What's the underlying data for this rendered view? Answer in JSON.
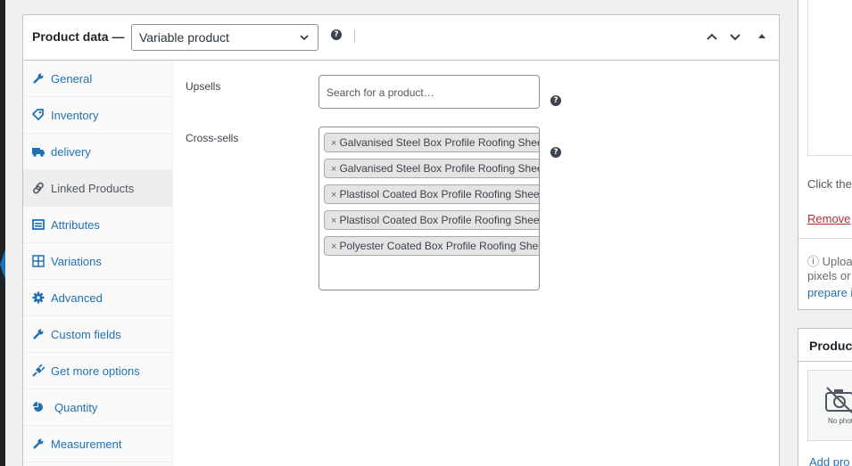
{
  "header": {
    "title": "Product data —",
    "type_select": "Variable product"
  },
  "tabs": [
    {
      "label": "General",
      "icon": "wrench-icon"
    },
    {
      "label": "Inventory",
      "icon": "tag-icon"
    },
    {
      "label": "delivery",
      "icon": "truck-icon"
    },
    {
      "label": "Linked Products",
      "icon": "link-icon",
      "active": true
    },
    {
      "label": "Attributes",
      "icon": "list-icon"
    },
    {
      "label": "Variations",
      "icon": "grid-icon"
    },
    {
      "label": "Advanced",
      "icon": "gear-icon"
    },
    {
      "label": "Custom fields",
      "icon": "wrench-icon"
    },
    {
      "label": "Get more options",
      "icon": "plug-icon"
    },
    {
      "label": "Quantity",
      "icon": "pie-icon"
    },
    {
      "label": "Measurement",
      "icon": "wrench-icon"
    }
  ],
  "linked": {
    "upsells_label": "Upsells",
    "upsells_placeholder": "Search for a product…",
    "crosssells_label": "Cross-sells",
    "crosssells": [
      "Galvanised Steel Box Profile Roofing Sheet",
      "Galvanised Steel Box Profile Roofing Sheet",
      "Plastisol Coated Box Profile Roofing Sheet",
      "Plastisol Coated Box Profile Roofing Sheet",
      "Polyester Coated Box Profile Roofing Sheet"
    ]
  },
  "sidebar": {
    "click_text": "Click the",
    "remove_link": "Remove",
    "upload_line1": "ⓘ Uploa",
    "upload_line2": "pixels or",
    "upload_link": "prepare i",
    "gallery_title": "Product",
    "no_photo": "No photo",
    "add_link": "Add pro"
  },
  "colors": {
    "link": "#2271b1",
    "remove": "#b32d2e"
  }
}
